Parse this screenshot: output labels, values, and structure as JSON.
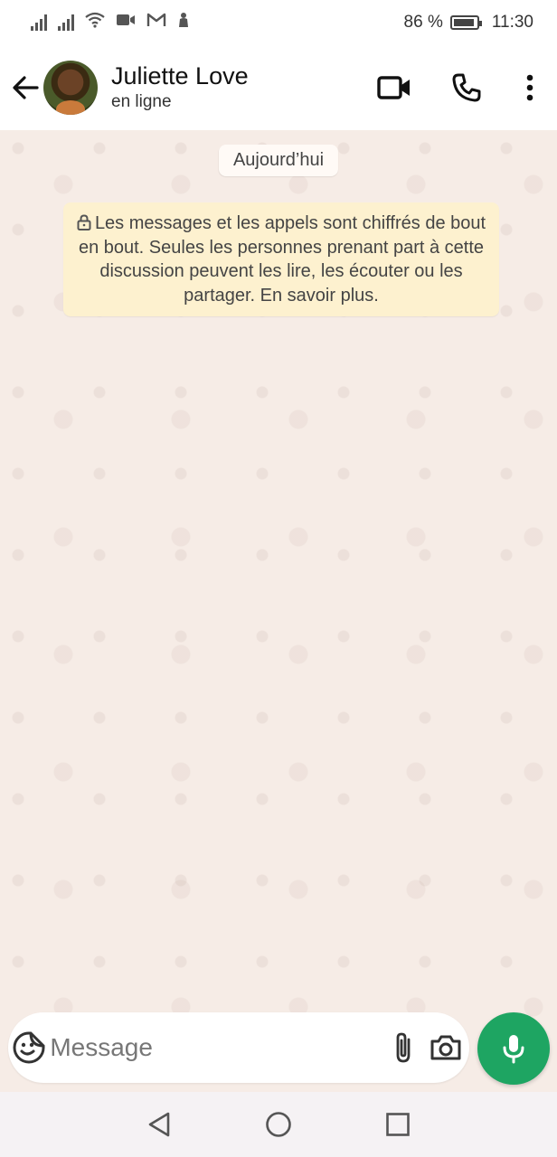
{
  "status_bar": {
    "battery": "86 %",
    "time": "11:30",
    "icons": [
      "signal-icon",
      "signal-icon",
      "wifi-icon",
      "video-call-icon",
      "gmail-icon",
      "notification-icon",
      "battery-icon"
    ]
  },
  "header": {
    "contact_name": "Juliette Love",
    "contact_status": "en ligne",
    "icons": [
      "back-arrow-icon",
      "video-call-icon",
      "phone-icon",
      "more-vert-icon"
    ]
  },
  "chat": {
    "date_chip": "Aujourd’hui",
    "encryption_notice": "Les messages et les appels sont chiffrés de bout en bout. Seules les personnes prenant part à cette discussion peuvent les lire, les écouter ou les partager. En savoir plus."
  },
  "composer": {
    "placeholder": "Message",
    "icons": [
      "sticker-icon",
      "attach-icon",
      "camera-icon",
      "mic-icon"
    ]
  },
  "navigation": {
    "icons": [
      "back-triangle-icon",
      "home-circle-icon",
      "recents-square-icon"
    ]
  },
  "colors": {
    "accent_green": "#1ea562",
    "chat_background": "#f6ece6",
    "notice_background": "#fdf1cf",
    "header_background": "#ffffff"
  }
}
